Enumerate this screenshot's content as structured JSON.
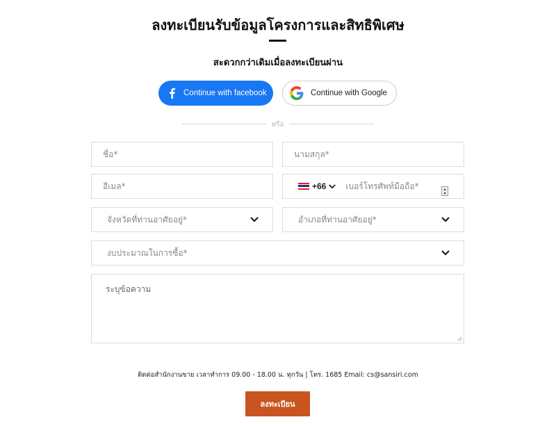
{
  "header": {
    "title": "ลงทะเบียนรับข้อมูลโครงการและสิทธิพิเศษ",
    "subtitle": "สะดวกกว่าเดิมเมื่อลงทะเบียนผ่าน"
  },
  "social": {
    "facebook_label": "Continue with facebook",
    "google_label": "Continue with Google",
    "facebook_color": "#1877f2"
  },
  "divider": {
    "label": "หรือ"
  },
  "form": {
    "first_name_placeholder": "ชื่อ*",
    "last_name_placeholder": "นามสกุล*",
    "email_placeholder": "อีเมล*",
    "phone": {
      "country_flag": "thailand-flag-icon",
      "dial_code": "+66",
      "placeholder": "เบอร์โทรศัพท์มือถือ*"
    },
    "province_label": "จังหวัดที่ท่านอาศัยอยู่*",
    "district_label": "อำเภอที่ท่านอาศัยอยู่*",
    "budget_label": "งบประมาณในการซื้อ*",
    "message_placeholder": "ระบุข้อความ"
  },
  "footer": {
    "contact_text": "ติดต่อสำนักงานขาย เวลาทำการ 09.00 - 18.00 น. ทุกวัน | โทร. 1685 Email: cs@sansiri.com",
    "submit_label": "ลงทะเบียน",
    "submit_color": "#c9541f"
  }
}
